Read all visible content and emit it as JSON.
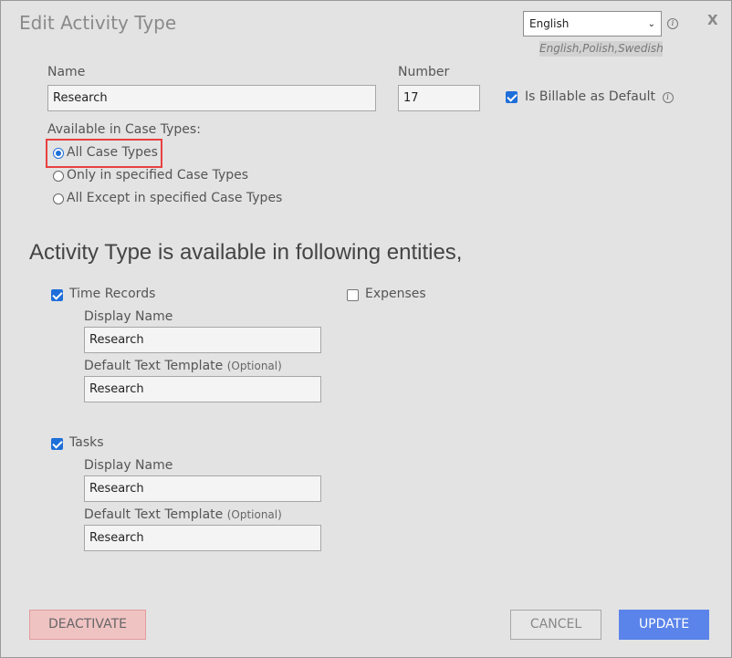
{
  "dialog": {
    "title": "Edit Activity Type",
    "close_label": "X",
    "language": {
      "selected": "English",
      "available": "English,Polish,Swedish"
    }
  },
  "form": {
    "name_label": "Name",
    "name_value": "Research",
    "number_label": "Number",
    "number_value": "17",
    "billable_label": "Is Billable as Default",
    "billable_checked": true,
    "case_types_label": "Available in Case Types:",
    "case_type_options": [
      "All Case Types",
      "Only in specified Case Types",
      "All Except in specified Case Types"
    ],
    "case_type_selected": 0
  },
  "entities": {
    "heading": "Activity Type is available in following entities,",
    "time_records": {
      "label": "Time Records",
      "checked": true,
      "display_name_label": "Display Name",
      "display_name_value": "Research",
      "template_label": "Default Text Template",
      "optional": "(Optional)",
      "template_value": "Research"
    },
    "expenses": {
      "label": "Expenses",
      "checked": false
    },
    "tasks": {
      "label": "Tasks",
      "checked": true,
      "display_name_label": "Display Name",
      "display_name_value": "Research",
      "template_label": "Default Text Template",
      "optional": "(Optional)",
      "template_value": "Research"
    }
  },
  "buttons": {
    "deactivate": "DEACTIVATE",
    "cancel": "CANCEL",
    "update": "UPDATE"
  },
  "colors": {
    "accent": "#1e6fd9",
    "update_button": "#5b84ea",
    "deactivate_button": "#f0c3c3",
    "highlight": "#e84040"
  }
}
